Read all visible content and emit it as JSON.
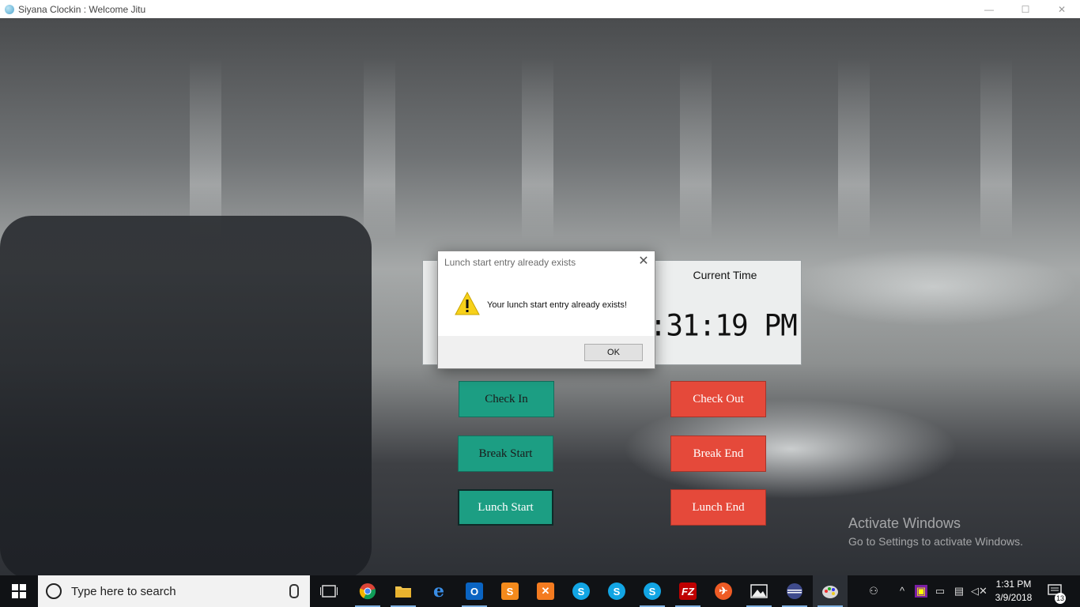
{
  "window": {
    "title": "Siyana Clockin : Welcome Jitu",
    "minimize": "—",
    "maximize": "☐",
    "close": "✕"
  },
  "clock_panel": {
    "label": "Current Time",
    "time": "1:31:19 PM"
  },
  "buttons": {
    "check_in": "Check In",
    "check_out": "Check Out",
    "break_start": "Break Start",
    "break_end": "Break End",
    "lunch_start": "Lunch Start",
    "lunch_end": "Lunch End"
  },
  "dialog": {
    "title": "Lunch start entry already exists",
    "message": "Your lunch start entry already exists!",
    "ok_label": "OK",
    "close_glyph": "✕"
  },
  "watermark": {
    "line1": "Activate Windows",
    "line2": "Go to Settings to activate Windows."
  },
  "taskbar": {
    "search_placeholder": "Type here to search",
    "time": "1:31 PM",
    "date": "3/9/2018",
    "notification_count": "13",
    "apps": [
      "task-view",
      "chrome",
      "file-explorer",
      "edge",
      "outlook",
      "sublime-text",
      "xampp",
      "skype",
      "skype-2",
      "skype-business",
      "filezilla",
      "postman",
      "photos",
      "eclipse",
      "paint"
    ]
  },
  "colors": {
    "green_button": "#1c9e83",
    "red_button": "#e5493a",
    "taskbar": "#101215"
  }
}
